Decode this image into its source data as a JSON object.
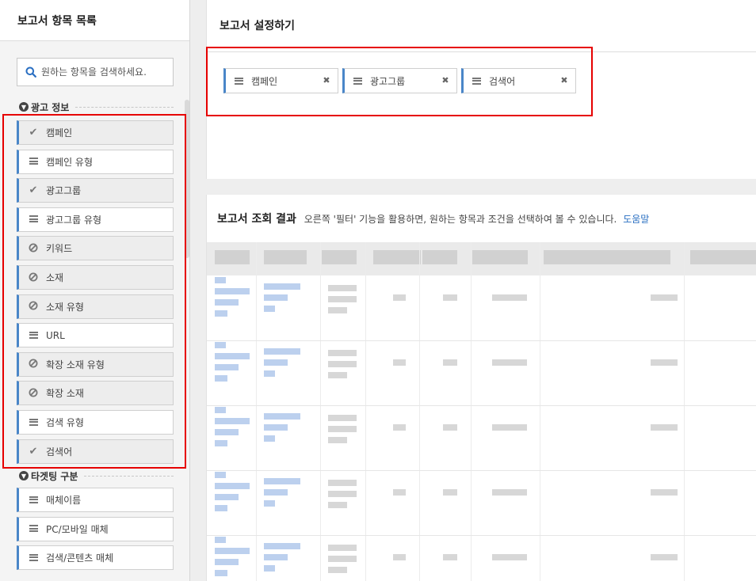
{
  "left_panel": {
    "title": "보고서 항목 목록",
    "search": {
      "placeholder": "원하는 항목을 검색하세요."
    },
    "sections": [
      {
        "title": "광고 정보",
        "items": [
          {
            "label": "캠페인",
            "icon": "check-icon",
            "used": true
          },
          {
            "label": "캠페인 유형",
            "icon": "hamburger-icon",
            "used": false
          },
          {
            "label": "광고그룹",
            "icon": "check-icon",
            "used": true
          },
          {
            "label": "광고그룹 유형",
            "icon": "hamburger-icon",
            "used": false
          },
          {
            "label": "키워드",
            "icon": "ban-icon",
            "used": true
          },
          {
            "label": "소재",
            "icon": "ban-icon",
            "used": true
          },
          {
            "label": "소재 유형",
            "icon": "ban-icon",
            "used": true
          },
          {
            "label": "URL",
            "icon": "hamburger-icon",
            "used": false
          },
          {
            "label": "확장 소재 유형",
            "icon": "ban-icon",
            "used": true
          },
          {
            "label": "확장 소재",
            "icon": "ban-icon",
            "used": true
          },
          {
            "label": "검색 유형",
            "icon": "hamburger-icon",
            "used": false
          },
          {
            "label": "검색어",
            "icon": "check-icon",
            "used": true
          }
        ]
      },
      {
        "title": "타겟팅 구분",
        "items": [
          {
            "label": "매체이름",
            "icon": "hamburger-icon",
            "used": false
          },
          {
            "label": "PC/모바일 매체",
            "icon": "hamburger-icon",
            "used": false
          },
          {
            "label": "검색/콘텐츠 매체",
            "icon": "hamburger-icon",
            "used": false
          }
        ]
      }
    ]
  },
  "settings": {
    "title": "보고서 설정하기",
    "chips": [
      "캠페인",
      "광고그룹",
      "검색어"
    ]
  },
  "result": {
    "title": "보고서 조회 결과",
    "description": "오른쪽 '필터' 기능을 활용하면, 원하는 항목과 조건을 선택하여 볼 수 있습니다.",
    "help_link": "도움말"
  },
  "colors": {
    "accent": "#4a86c8",
    "highlight": "#e60000",
    "link": "#2a6fc2"
  }
}
